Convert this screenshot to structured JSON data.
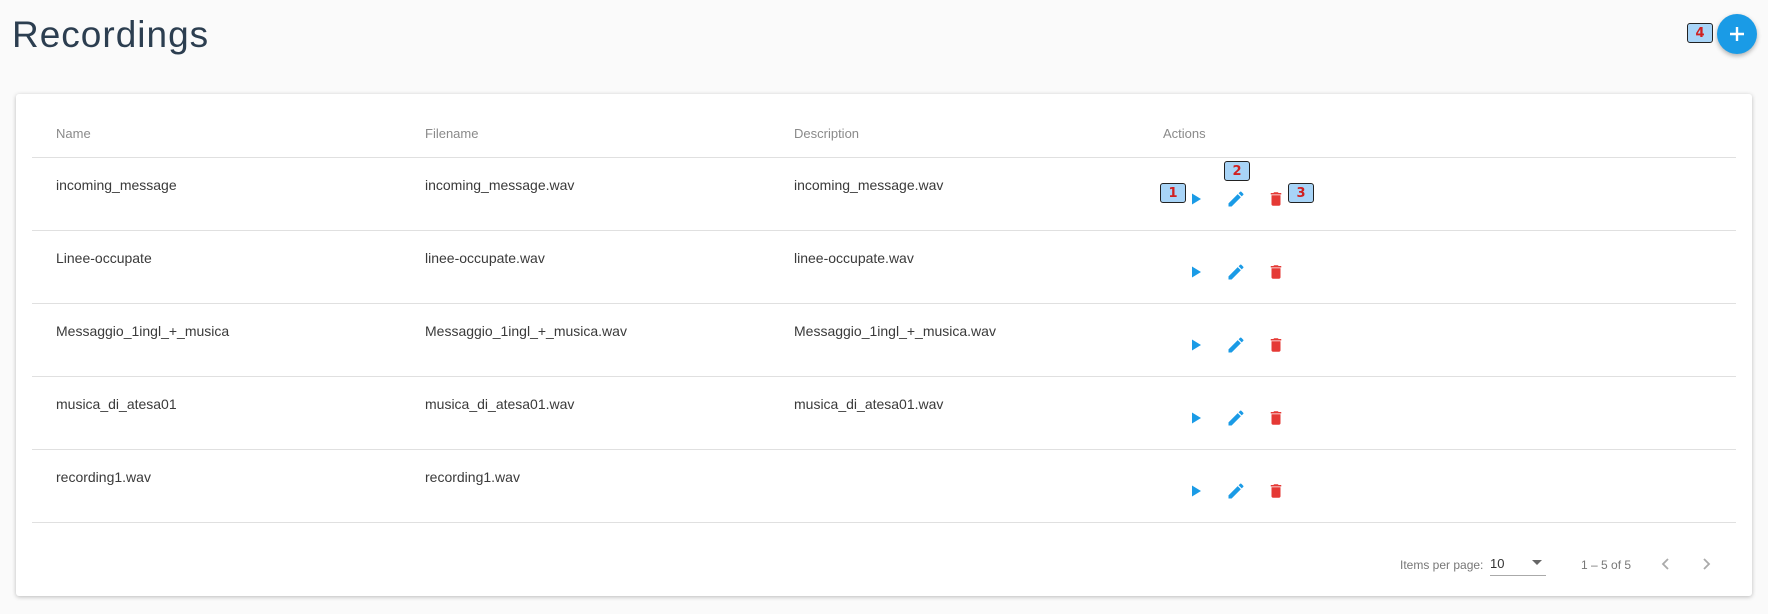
{
  "page": {
    "title": "Recordings"
  },
  "fab": {
    "icon": "plus-icon"
  },
  "markers": [
    "1",
    "2",
    "3",
    "4"
  ],
  "table": {
    "headers": {
      "name": "Name",
      "filename": "Filename",
      "description": "Description",
      "actions": "Actions"
    },
    "rows": [
      {
        "name": "incoming_message",
        "filename": "incoming_message.wav",
        "description": "incoming_message.wav"
      },
      {
        "name": "Linee-occupate",
        "filename": "linee-occupate.wav",
        "description": "linee-occupate.wav"
      },
      {
        "name": "Messaggio_1ingl_+_musica",
        "filename": "Messaggio_1ingl_+_musica.wav",
        "description": "Messaggio_1ingl_+_musica.wav"
      },
      {
        "name": "musica_di_atesa01",
        "filename": "musica_di_atesa01.wav",
        "description": "musica_di_atesa01.wav"
      },
      {
        "name": "recording1.wav",
        "filename": "recording1.wav",
        "description": ""
      }
    ]
  },
  "paginator": {
    "items_per_page_label": "Items per page:",
    "items_per_page_value": "10",
    "range_label": "1 – 5 of 5"
  },
  "colors": {
    "accent": "#1a9be6",
    "danger": "#e53935"
  }
}
